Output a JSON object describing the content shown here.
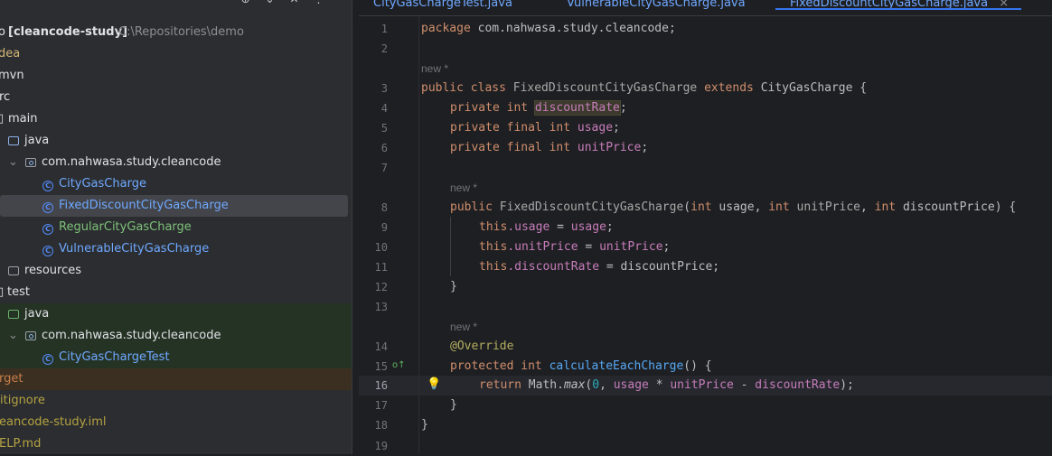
{
  "toolbar": {
    "icons": [
      "crosshair-icon",
      "chevron-down-icon",
      "close-icon",
      "more-icon"
    ],
    "glyphs": [
      "⊕",
      "⌄",
      "✕",
      "⋮"
    ]
  },
  "tree": {
    "root_name": "[cleancode-study]",
    "root_prefix": "o",
    "root_path": "C:\\Repositories\\demo",
    "rows": [
      {
        "label": "dea",
        "name": "tree-item-idea"
      },
      {
        "label": "mvn",
        "name": "tree-item-mvn"
      },
      {
        "label": "rc",
        "name": "tree-item-src"
      },
      {
        "label": "main",
        "name": "tree-item-main"
      },
      {
        "label": "java",
        "name": "tree-item-main-java"
      },
      {
        "label": "com.nahwasa.study.cleancode",
        "name": "tree-item-main-package"
      },
      {
        "label": "CityGasCharge",
        "name": "tree-item-citygascharge"
      },
      {
        "label": "FixedDiscountCityGasCharge",
        "name": "tree-item-fixeddiscountcitygascharge"
      },
      {
        "label": "RegularCityGasCharge",
        "name": "tree-item-regularcitygascharge"
      },
      {
        "label": "VulnerableCityGasCharge",
        "name": "tree-item-vulnerablecitygascharge"
      },
      {
        "label": "resources",
        "name": "tree-item-resources"
      },
      {
        "label": "test",
        "name": "tree-item-test"
      },
      {
        "label": "java",
        "name": "tree-item-test-java"
      },
      {
        "label": "com.nahwasa.study.cleancode",
        "name": "tree-item-test-package"
      },
      {
        "label": "CityGasChargeTest",
        "name": "tree-item-citygaschargetest"
      },
      {
        "label": "rget",
        "name": "tree-item-target"
      },
      {
        "label": "itignore",
        "name": "tree-item-gitignore"
      },
      {
        "label": "eancode-study.iml",
        "name": "tree-item-iml"
      },
      {
        "label": "ELP.md",
        "name": "tree-item-help"
      }
    ]
  },
  "tabs": [
    {
      "label": "CityGasChargeTest.java"
    },
    {
      "label": "VulnerableCityGasCharge.java"
    },
    {
      "label": "FixedDiscountCityGasCharge.java",
      "active": true,
      "close": "×"
    }
  ],
  "editor": {
    "current_line": 16,
    "line_numbers": [
      "1",
      "2",
      "3",
      "4",
      "5",
      "6",
      "7",
      "8",
      "9",
      "10",
      "11",
      "12",
      "13",
      "14",
      "15",
      "16",
      "17",
      "18",
      "19"
    ],
    "hints": [
      "new *",
      "new *",
      "new *"
    ],
    "lines": {
      "l1_kw": "package",
      "l1_rest": " com.nahwasa.study.cleancode;",
      "l3_kw1": "public class",
      "l3_cls": " FixedDiscountCityGasCharge ",
      "l3_kw2": "extends",
      "l3_sup": " CityGasCharge {",
      "l4_kw": "private int",
      "l4_fld": "discountRate",
      "l4_end": ";",
      "l5_kw": "private final int",
      "l5_fld": " usage",
      "l5_end": ";",
      "l6_kw": "private final int",
      "l6_fld": " unitPrice",
      "l6_end": ";",
      "l8_kw": "public",
      "l8_cls": " FixedDiscountCityGasCharge",
      "l8_p1": "(",
      "l8_t1": "int",
      "l8_a1": " usage, ",
      "l8_t2": "int",
      "l8_a2": " unitPrice",
      "l8_c": ", ",
      "l8_t3": "int",
      "l8_a3": " discountPrice) {",
      "l9_this": "this",
      "l9_fld": ".usage",
      "l9_eq": " = ",
      "l9_val": "usage",
      "l9_end": ";",
      "l10_this": "this",
      "l10_fld": ".unitPrice",
      "l10_eq": " = ",
      "l10_val": "unitPrice",
      "l10_end": ";",
      "l11_this": "this",
      "l11_fld": ".discountRate",
      "l11_rest": " = discountPrice;",
      "l12": "}",
      "l14_ann": "@Override",
      "l15_kw": "protected int",
      "l15_mth": " calculateEachCharge",
      "l15_rest": "() {",
      "l16_kw": "return",
      "l16_cls": " Math.",
      "l16_mth": "max",
      "l16_p": "(",
      "l16_num": "0",
      "l16_c": ", ",
      "l16_f1": "usage",
      "l16_op": " * ",
      "l16_f2": "unitPrice",
      "l16_op2": " - ",
      "l16_f3": "discountRate",
      "l16_end": ");",
      "l17": "}",
      "l18": "}"
    }
  },
  "gutter": {
    "bulb_icon": "💡",
    "override_icon": "o↑"
  },
  "colors": {
    "keyword": "#cf8e6d",
    "field": "#c77dbb",
    "method": "#56a8f5",
    "number": "#2aacb8",
    "annotation": "#b3ae60",
    "accent": "#3574f0"
  }
}
